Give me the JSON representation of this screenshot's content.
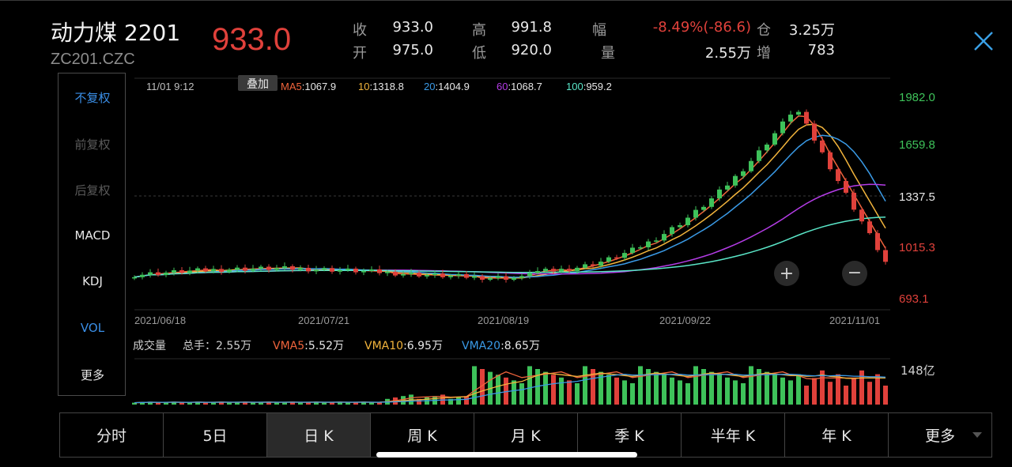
{
  "header": {
    "name": "动力煤 2201",
    "code": "ZC201.CZC",
    "price": "933.0",
    "stats": [
      {
        "label": "收",
        "value": "933.0"
      },
      {
        "label": "高",
        "value": "991.8"
      },
      {
        "label": "幅",
        "value": "-8.49%(-86.6)"
      },
      {
        "label": "仓",
        "value": "3.25万"
      },
      {
        "label": "开",
        "value": "975.0"
      },
      {
        "label": "低",
        "value": "920.0"
      },
      {
        "label": "量",
        "value": "2.55万"
      },
      {
        "label": "增",
        "value": "783"
      }
    ]
  },
  "left_menu": [
    {
      "label": "不复权",
      "color": "#3a8ee6"
    },
    {
      "label": "前复权",
      "color": "#5a5a5a"
    },
    {
      "label": "后复权",
      "color": "#5a5a5a"
    },
    {
      "label": "MACD",
      "color": "#e8e8e8"
    },
    {
      "label": "KDJ",
      "color": "#e8e8e8"
    },
    {
      "label": "VOL",
      "color": "#3a8ee6"
    },
    {
      "label": "更多",
      "color": "#e8e8e8"
    }
  ],
  "chart_info": {
    "time": "11/01 9:12",
    "overlay_btn": "叠加",
    "ma_items": [
      {
        "label": "MA5",
        "value": ":1067.9",
        "color": "#f0643c"
      },
      {
        "label": "10",
        "value": ":1318.8",
        "color": "#f2b43c"
      },
      {
        "label": "20",
        "value": ":1404.9",
        "color": "#3a9ae6"
      },
      {
        "label": "60",
        "value": ":1068.7",
        "color": "#b43ce6"
      },
      {
        "label": "100",
        "value": ":959.2",
        "color": "#5ae6c8"
      }
    ],
    "vol_label": "成交量",
    "vol_total": "总手：2.55万",
    "vma_items": [
      {
        "label": "VMA5",
        "value": ":5.52万",
        "color": "#f0643c"
      },
      {
        "label": "VMA10",
        "value": ":6.95万",
        "color": "#f2b43c"
      },
      {
        "label": "VMA20",
        "value": ":8.65万",
        "color": "#3a9ae6"
      }
    ],
    "vol_axis_label": "148亿"
  },
  "chart_data": {
    "type": "candlestick",
    "price_ticks": [
      "1982.0",
      "1659.8",
      "1337.5",
      "1015.3",
      "693.1"
    ],
    "price_tick_colors": [
      "#3ec25a",
      "#3ec25a",
      "#e6e6e6",
      "#e0413b",
      "#e0413b"
    ],
    "ylim": [
      693.1,
      1982.0
    ],
    "date_ticks": [
      "2021/06/18",
      "2021/07/21",
      "2021/08/19",
      "2021/09/22",
      "2021/11/01"
    ],
    "up_color": "#3ec25a",
    "down_color": "#e0413b"
  },
  "tabs": [
    "分时",
    "5日",
    "日 K",
    "周 K",
    "月 K",
    "季 K",
    "半年 K",
    "年 K",
    "更多"
  ],
  "active_tab": 2
}
